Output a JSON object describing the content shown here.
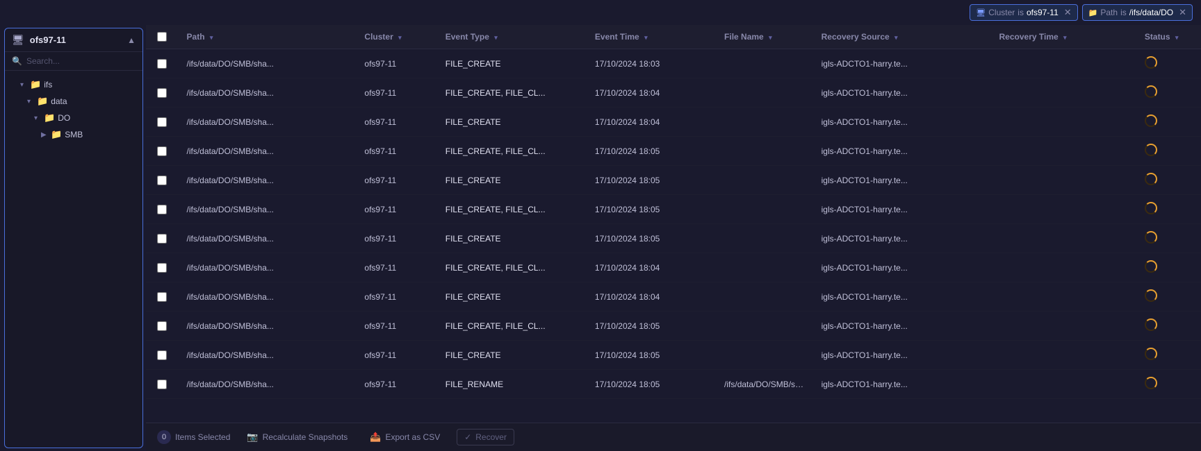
{
  "topbar": {
    "filters": [
      {
        "id": "cluster-filter",
        "icon": "🖥",
        "key": "Cluster",
        "op": "is",
        "value": "ofs97-11"
      },
      {
        "id": "path-filter",
        "icon": "📁",
        "key": "Path",
        "op": "is",
        "value": "/ifs/data/DO"
      }
    ]
  },
  "sidebar": {
    "title": "ofs97-11",
    "search_placeholder": "Search...",
    "tree": [
      {
        "id": "ifs",
        "label": "ifs",
        "level": 1,
        "expanded": true,
        "type": "folder"
      },
      {
        "id": "data",
        "label": "data",
        "level": 2,
        "expanded": true,
        "type": "folder"
      },
      {
        "id": "DO",
        "label": "DO",
        "level": 3,
        "expanded": true,
        "type": "folder"
      },
      {
        "id": "SMB",
        "label": "SMB",
        "level": 4,
        "expanded": false,
        "type": "folder"
      }
    ]
  },
  "table": {
    "columns": [
      {
        "id": "check",
        "label": ""
      },
      {
        "id": "path",
        "label": "Path"
      },
      {
        "id": "cluster",
        "label": "Cluster"
      },
      {
        "id": "event_type",
        "label": "Event Type"
      },
      {
        "id": "event_time",
        "label": "Event Time"
      },
      {
        "id": "file_name",
        "label": "File Name"
      },
      {
        "id": "recovery_source",
        "label": "Recovery Source"
      },
      {
        "id": "recovery_time",
        "label": "Recovery Time"
      },
      {
        "id": "status",
        "label": "Status"
      }
    ],
    "rows": [
      {
        "path": "/ifs/data/DO/SMB/sha...",
        "cluster": "ofs97-11",
        "event_type": "FILE_CREATE",
        "event_time": "17/10/2024 18:03",
        "file_name": "",
        "recovery_source": "igls-ADCTO1-harry.te...",
        "recovery_time": "",
        "status": "spinner"
      },
      {
        "path": "/ifs/data/DO/SMB/sha...",
        "cluster": "ofs97-11",
        "event_type": "FILE_CREATE, FILE_CL...",
        "event_time": "17/10/2024 18:04",
        "file_name": "",
        "recovery_source": "igls-ADCTO1-harry.te...",
        "recovery_time": "",
        "status": "spinner"
      },
      {
        "path": "/ifs/data/DO/SMB/sha...",
        "cluster": "ofs97-11",
        "event_type": "FILE_CREATE",
        "event_time": "17/10/2024 18:04",
        "file_name": "",
        "recovery_source": "igls-ADCTO1-harry.te...",
        "recovery_time": "",
        "status": "spinner"
      },
      {
        "path": "/ifs/data/DO/SMB/sha...",
        "cluster": "ofs97-11",
        "event_type": "FILE_CREATE, FILE_CL...",
        "event_time": "17/10/2024 18:05",
        "file_name": "",
        "recovery_source": "igls-ADCTO1-harry.te...",
        "recovery_time": "",
        "status": "spinner"
      },
      {
        "path": "/ifs/data/DO/SMB/sha...",
        "cluster": "ofs97-11",
        "event_type": "FILE_CREATE",
        "event_time": "17/10/2024 18:05",
        "file_name": "",
        "recovery_source": "igls-ADCTO1-harry.te...",
        "recovery_time": "",
        "status": "spinner"
      },
      {
        "path": "/ifs/data/DO/SMB/sha...",
        "cluster": "ofs97-11",
        "event_type": "FILE_CREATE, FILE_CL...",
        "event_time": "17/10/2024 18:05",
        "file_name": "",
        "recovery_source": "igls-ADCTO1-harry.te...",
        "recovery_time": "",
        "status": "spinner"
      },
      {
        "path": "/ifs/data/DO/SMB/sha...",
        "cluster": "ofs97-11",
        "event_type": "FILE_CREATE",
        "event_time": "17/10/2024 18:05",
        "file_name": "",
        "recovery_source": "igls-ADCTO1-harry.te...",
        "recovery_time": "",
        "status": "spinner"
      },
      {
        "path": "/ifs/data/DO/SMB/sha...",
        "cluster": "ofs97-11",
        "event_type": "FILE_CREATE, FILE_CL...",
        "event_time": "17/10/2024 18:04",
        "file_name": "",
        "recovery_source": "igls-ADCTO1-harry.te...",
        "recovery_time": "",
        "status": "spinner"
      },
      {
        "path": "/ifs/data/DO/SMB/sha...",
        "cluster": "ofs97-11",
        "event_type": "FILE_CREATE",
        "event_time": "17/10/2024 18:04",
        "file_name": "",
        "recovery_source": "igls-ADCTO1-harry.te...",
        "recovery_time": "",
        "status": "spinner"
      },
      {
        "path": "/ifs/data/DO/SMB/sha...",
        "cluster": "ofs97-11",
        "event_type": "FILE_CREATE, FILE_CL...",
        "event_time": "17/10/2024 18:05",
        "file_name": "",
        "recovery_source": "igls-ADCTO1-harry.te...",
        "recovery_time": "",
        "status": "spinner"
      },
      {
        "path": "/ifs/data/DO/SMB/sha...",
        "cluster": "ofs97-11",
        "event_type": "FILE_CREATE",
        "event_time": "17/10/2024 18:05",
        "file_name": "",
        "recovery_source": "igls-ADCTO1-harry.te...",
        "recovery_time": "",
        "status": "spinner"
      },
      {
        "path": "/ifs/data/DO/SMB/sha...",
        "cluster": "ofs97-11",
        "event_type": "FILE_RENAME",
        "event_time": "17/10/2024 18:05",
        "file_name": "/ifs/data/DO/SMB/sha...",
        "recovery_source": "igls-ADCTO1-harry.te...",
        "recovery_time": "",
        "status": "spinner"
      }
    ]
  },
  "bottombar": {
    "items_selected_label": "Items Selected",
    "recalculate_label": "Recalculate Snapshots",
    "export_label": "Export as CSV",
    "recover_label": "Recover"
  }
}
